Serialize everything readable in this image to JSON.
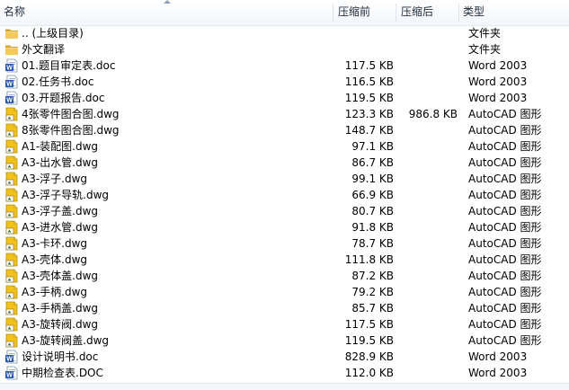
{
  "columns": {
    "name": "名称",
    "size_before": "压缩前",
    "size_after": "压缩后",
    "type": "类型"
  },
  "files": [
    {
      "name": ".. (上级目录)",
      "size_before": "",
      "size_after": "",
      "type": "文件夹",
      "icon": "folder-icon"
    },
    {
      "name": "外文翻译",
      "size_before": "",
      "size_after": "",
      "type": "文件夹",
      "icon": "folder-icon"
    },
    {
      "name": "01.题目审定表.doc",
      "size_before": "117.5 KB",
      "size_after": "",
      "type": "Word 2003",
      "icon": "word-doc-icon"
    },
    {
      "name": "02.任务书.doc",
      "size_before": "116.5 KB",
      "size_after": "",
      "type": "Word 2003",
      "icon": "word-doc-icon"
    },
    {
      "name": "03.开题报告.doc",
      "size_before": "119.5 KB",
      "size_after": "",
      "type": "Word 2003",
      "icon": "word-doc-icon"
    },
    {
      "name": "4张零件图合图.dwg",
      "size_before": "123.3 KB",
      "size_after": "986.8 KB",
      "type": "AutoCAD 图形",
      "icon": "dwg-icon"
    },
    {
      "name": "8张零件图合图.dwg",
      "size_before": "148.7 KB",
      "size_after": "",
      "type": "AutoCAD 图形",
      "icon": "dwg-icon"
    },
    {
      "name": "A1-装配图.dwg",
      "size_before": "97.1 KB",
      "size_after": "",
      "type": "AutoCAD 图形",
      "icon": "dwg-icon"
    },
    {
      "name": "A3-出水管.dwg",
      "size_before": "86.7 KB",
      "size_after": "",
      "type": "AutoCAD 图形",
      "icon": "dwg-icon"
    },
    {
      "name": "A3-浮子.dwg",
      "size_before": "99.1 KB",
      "size_after": "",
      "type": "AutoCAD 图形",
      "icon": "dwg-icon"
    },
    {
      "name": "A3-浮子导轨.dwg",
      "size_before": "66.9 KB",
      "size_after": "",
      "type": "AutoCAD 图形",
      "icon": "dwg-icon"
    },
    {
      "name": "A3-浮子盖.dwg",
      "size_before": "80.7 KB",
      "size_after": "",
      "type": "AutoCAD 图形",
      "icon": "dwg-icon"
    },
    {
      "name": "A3-进水管.dwg",
      "size_before": "91.8 KB",
      "size_after": "",
      "type": "AutoCAD 图形",
      "icon": "dwg-icon"
    },
    {
      "name": "A3-卡环.dwg",
      "size_before": "78.7 KB",
      "size_after": "",
      "type": "AutoCAD 图形",
      "icon": "dwg-icon"
    },
    {
      "name": "A3-壳体.dwg",
      "size_before": "111.8 KB",
      "size_after": "",
      "type": "AutoCAD 图形",
      "icon": "dwg-icon"
    },
    {
      "name": "A3-壳体盖.dwg",
      "size_before": "87.2 KB",
      "size_after": "",
      "type": "AutoCAD 图形",
      "icon": "dwg-icon"
    },
    {
      "name": "A3-手柄.dwg",
      "size_before": "79.2 KB",
      "size_after": "",
      "type": "AutoCAD 图形",
      "icon": "dwg-icon"
    },
    {
      "name": "A3-手柄盖.dwg",
      "size_before": "85.7 KB",
      "size_after": "",
      "type": "AutoCAD 图形",
      "icon": "dwg-icon"
    },
    {
      "name": "A3-旋转阀.dwg",
      "size_before": "117.5 KB",
      "size_after": "",
      "type": "AutoCAD 图形",
      "icon": "dwg-icon"
    },
    {
      "name": "A3-旋转阀盖.dwg",
      "size_before": "119.5 KB",
      "size_after": "",
      "type": "AutoCAD 图形",
      "icon": "dwg-icon"
    },
    {
      "name": "设计说明书.doc",
      "size_before": "828.9 KB",
      "size_after": "",
      "type": "Word 2003",
      "icon": "word-doc-icon"
    },
    {
      "name": "中期检查表.DOC",
      "size_before": "112.0 KB",
      "size_after": "",
      "type": "Word 2003",
      "icon": "word-doc-icon"
    }
  ],
  "colors": {
    "folder": "#e8b640",
    "word_blue": "#2b5aa8",
    "dwg_yellow": "#f2c21b"
  }
}
